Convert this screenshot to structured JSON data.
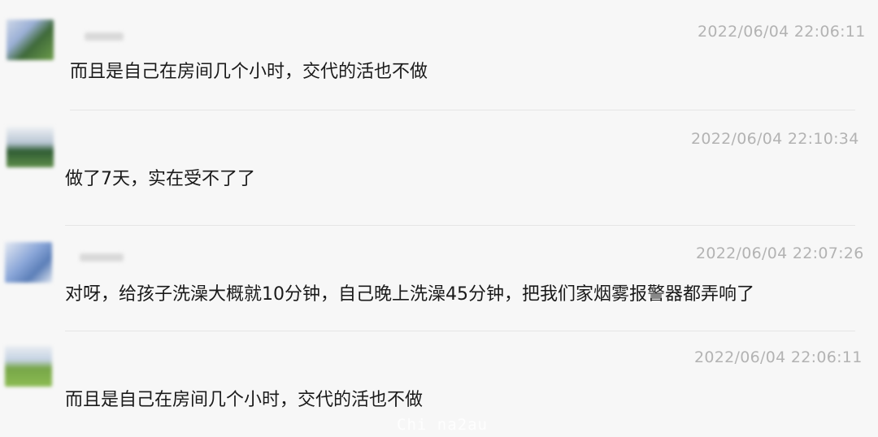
{
  "messages": [
    {
      "avatar_icon": "user-avatar-icon",
      "timestamp": "2022/06/04 22:06:11",
      "text": "而且是自己在房间几个小时，交代的活也不做"
    },
    {
      "avatar_icon": "user-avatar-icon",
      "timestamp": "2022/06/04 22:10:34",
      "text": "做了7天，实在受不了了"
    },
    {
      "avatar_icon": "user-avatar-icon",
      "timestamp": "2022/06/04 22:07:26",
      "text": "对呀，给孩子洗澡大概就10分钟，自己晚上洗澡45分钟，把我们家烟雾报警器都弄响了"
    },
    {
      "avatar_icon": "user-avatar-icon",
      "timestamp": "2022/06/04 22:06:11",
      "text": "而且是自己在房间几个小时，交代的活也不做"
    }
  ],
  "watermark": "Chi na2au",
  "colors": {
    "background": "#f7f7f7",
    "timestamp": "#b3b3b3",
    "message_text": "#1a1a1a",
    "divider": "#e6e6e6"
  }
}
